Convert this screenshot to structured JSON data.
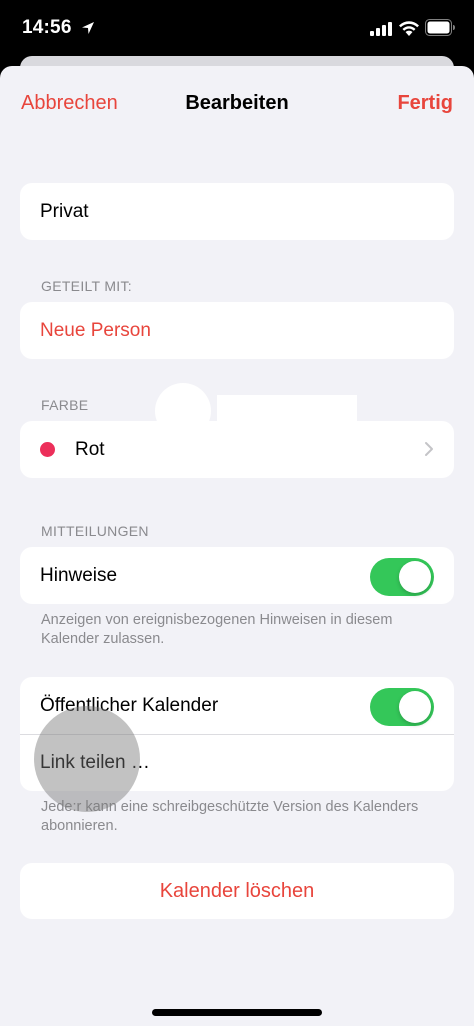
{
  "status_bar": {
    "time": "14:56"
  },
  "nav": {
    "cancel": "Abbrechen",
    "title": "Bearbeiten",
    "done": "Fertig"
  },
  "calendar_name": "Privat",
  "shared": {
    "label": "GETEILT MIT:",
    "add_person": "Neue Person"
  },
  "color": {
    "label": "FARBE",
    "value": "Rot",
    "hex": "#ec2f5a"
  },
  "notifications": {
    "label": "MITTEILUNGEN",
    "alerts_label": "Hinweise",
    "alerts_on": true,
    "footnote": "Anzeigen von ereignisbezogenen Hinweisen in diesem Kalender zulassen."
  },
  "public": {
    "label": "Öffentlicher Kalender",
    "on": true,
    "share_link": "Link teilen …",
    "footnote": "Jede:r kann eine schreibgeschützte Version des Kalenders abonnieren."
  },
  "delete_label": "Kalender löschen",
  "colors": {
    "accent": "#e8453c",
    "toggle_on": "#34c759",
    "background": "#f2f2f7"
  }
}
